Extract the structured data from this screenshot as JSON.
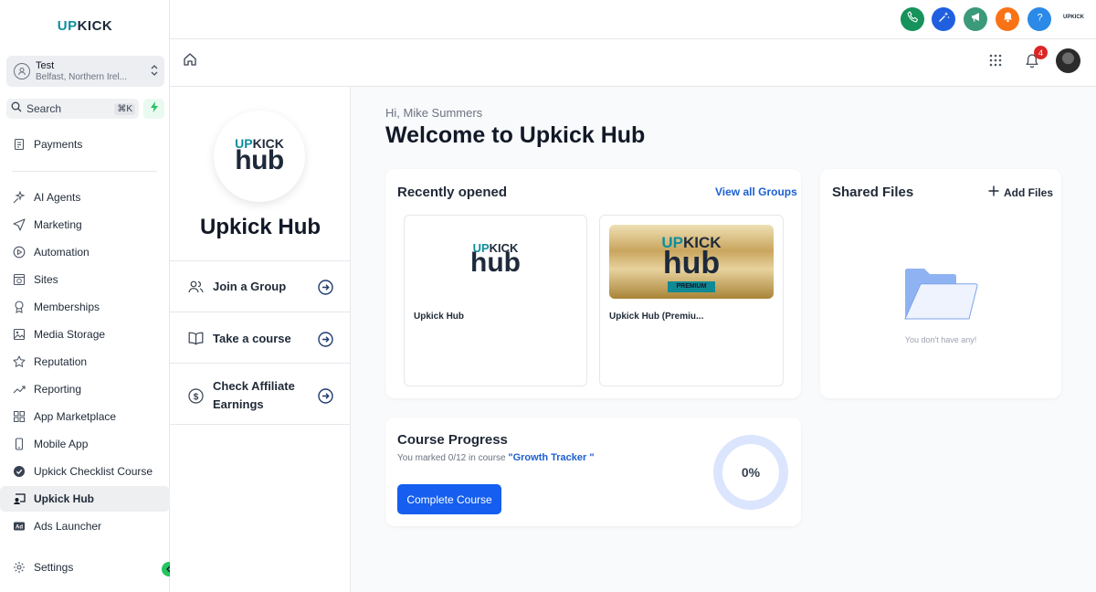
{
  "brand": {
    "up": "UP",
    "kick": "KICK",
    "up_color": "#0e8e9e",
    "kick_color": "#1e2a3b"
  },
  "location": {
    "name": "Test",
    "address": "Belfast, Northern Irel..."
  },
  "search": {
    "label": "Search",
    "shortcut": "⌘K"
  },
  "sidebar": {
    "items": [
      {
        "label": "Payments",
        "icon": "receipt-icon"
      },
      {
        "label": "AI Agents",
        "icon": "sparkles-icon"
      },
      {
        "label": "Marketing",
        "icon": "send-icon"
      },
      {
        "label": "Automation",
        "icon": "play-circle-icon"
      },
      {
        "label": "Sites",
        "icon": "globe-page-icon"
      },
      {
        "label": "Memberships",
        "icon": "award-icon"
      },
      {
        "label": "Media Storage",
        "icon": "image-icon"
      },
      {
        "label": "Reputation",
        "icon": "star-icon"
      },
      {
        "label": "Reporting",
        "icon": "trend-icon"
      },
      {
        "label": "App Marketplace",
        "icon": "grid-icon"
      },
      {
        "label": "Mobile App",
        "icon": "phone-icon"
      },
      {
        "label": "Upkick Checklist Course",
        "icon": "check-circle-icon"
      },
      {
        "label": "Upkick Hub",
        "icon": "monitor-user-icon",
        "active": true
      },
      {
        "label": "Ads Launcher",
        "icon": "ad-icon"
      }
    ],
    "settings": "Settings"
  },
  "topbar": {
    "colors": {
      "phone": "#15935a",
      "magic": "#1f5fe0",
      "announce": "#3a9a7a",
      "bell": "#f97316",
      "help": "#2b8ae8"
    },
    "mini_logo": "UPKICK"
  },
  "subheader": {
    "notification_count": "4"
  },
  "hub": {
    "logo_up": "UP",
    "logo_kick": "KICK",
    "logo_hub": "hub",
    "title": "Upkick Hub",
    "actions": [
      {
        "label_line1": "Join a Group",
        "label_line2": ""
      },
      {
        "label_line1": "Take a course",
        "label_line2": ""
      },
      {
        "label_line1": "Check Affiliate",
        "label_line2": "Earnings"
      }
    ]
  },
  "main": {
    "greeting": "Hi, Mike Summers",
    "welcome": "Welcome to Upkick Hub",
    "recent": {
      "title": "Recently opened",
      "view_all": "View all Groups",
      "items": [
        {
          "caption": "Upkick Hub",
          "logo_up": "UP",
          "logo_kick": "KICK",
          "logo_hub": "hub"
        },
        {
          "caption": "Upkick Hub (Premiu...",
          "logo_up": "UP",
          "logo_kick": "KICK",
          "logo_hub": "hub",
          "badge": "PREMIUM"
        }
      ]
    },
    "shared": {
      "title": "Shared Files",
      "add_label": "Add Files",
      "empty": "You don't have any!"
    },
    "progress": {
      "title": "Course Progress",
      "text": "You marked 0/12 in course",
      "course": "\"Growth Tracker \"",
      "button": "Complete Course",
      "percent_label": "0%",
      "percent": 0
    }
  }
}
